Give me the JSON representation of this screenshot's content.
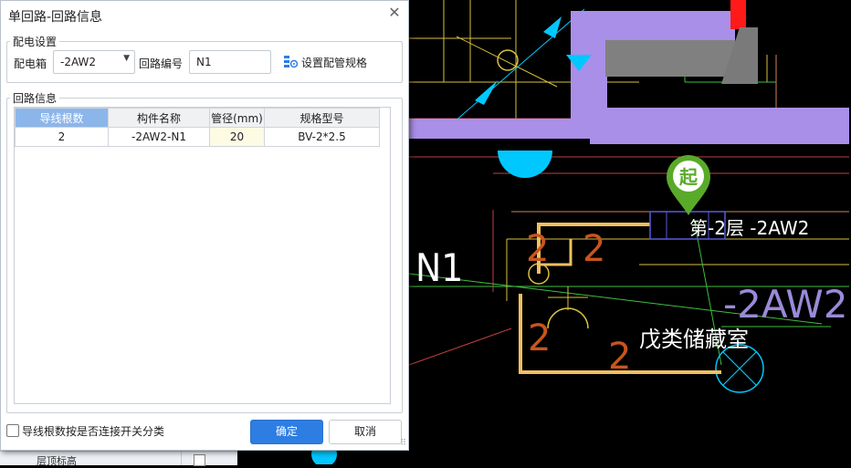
{
  "dialog": {
    "title": "单回路-回路信息",
    "close_glyph": "✕",
    "distribution": {
      "group_title": "配电设置",
      "box_label": "配电箱",
      "box_value": "-2AW2",
      "circuit_label": "回路编号",
      "circuit_value": "N1",
      "config_button": "设置配管规格"
    },
    "circuit_info": {
      "group_title": "回路信息",
      "columns": [
        "导线根数",
        "构件名称",
        "管径(mm)",
        "规格型号"
      ],
      "rows": [
        [
          "2",
          "-2AW2-N1",
          "20",
          "BV-2*2.5"
        ]
      ]
    },
    "classify_checkbox": {
      "label": "导线根数按是否连接开关分类",
      "checked": false
    },
    "ok_button": "确定",
    "cancel_button": "取消"
  },
  "under_panel": {
    "partial_label": "层顶标高"
  },
  "drawing": {
    "start_marker": "起",
    "floor_label": "第-2层 -2AW2",
    "circuit_label": "N1",
    "box_label": "-2AW2",
    "room_label": "戊类储藏室",
    "wire_counts": [
      "2",
      "2",
      "2",
      "2"
    ],
    "colors": {
      "background": "#000000",
      "duct": "#a98fe8",
      "wire": "#f0c060",
      "count": "#c8551c",
      "marker": "#5aaa2a",
      "accent": "#00c8ff",
      "box_text": "#9a8ad8"
    }
  }
}
